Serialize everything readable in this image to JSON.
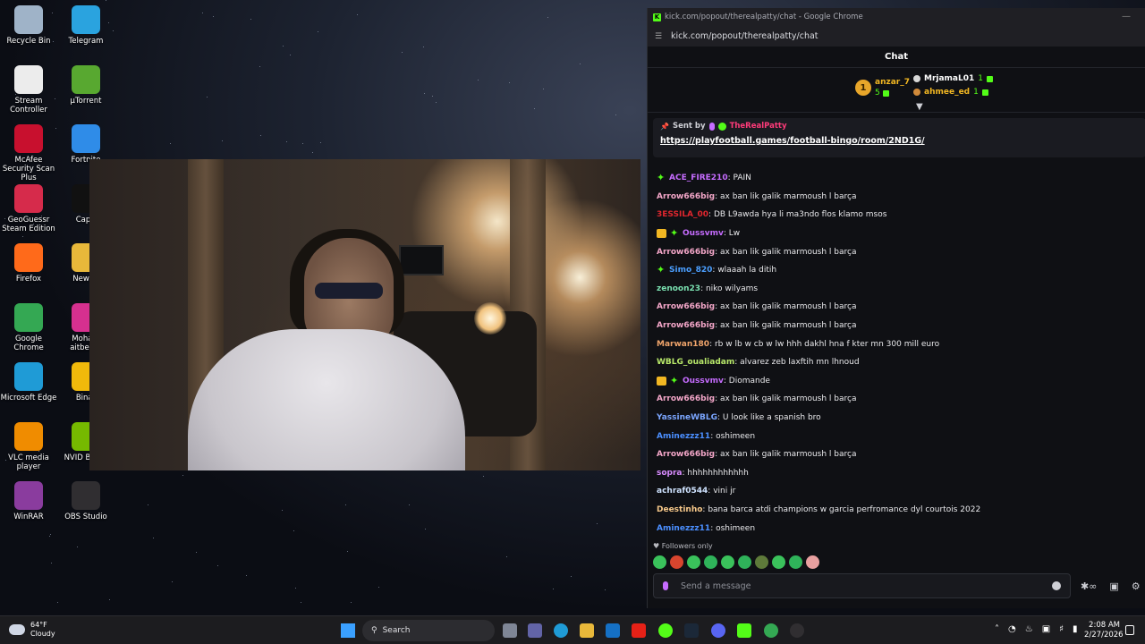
{
  "desktop_icons": [
    {
      "label": "Recycle Bin",
      "icon": "recycle-bin-icon",
      "color": "#9fb3c8"
    },
    {
      "label": "Telegram",
      "icon": "telegram-icon",
      "color": "#2aa3df"
    },
    {
      "label": "Stream Controller",
      "icon": "stream-controller-icon",
      "color": "#ececec"
    },
    {
      "label": "µTorrent",
      "icon": "utorrent-icon",
      "color": "#58a830"
    },
    {
      "label": "McAfee Security Scan Plus",
      "icon": "mcafee-icon",
      "color": "#c8102e"
    },
    {
      "label": "Fortnite",
      "icon": "fortnite-icon",
      "color": "#2f8ce8"
    },
    {
      "label": "GeoGuessr Steam Edition",
      "icon": "geoguessr-icon",
      "color": "#d62b4b"
    },
    {
      "label": "CapC",
      "icon": "capcut-icon",
      "color": "#111111"
    },
    {
      "label": "Firefox",
      "icon": "firefox-icon",
      "color": "#ff6a1a"
    },
    {
      "label": "New fo",
      "icon": "folder-icon",
      "color": "#e8b83a"
    },
    {
      "label": "Google Chrome",
      "icon": "chrome-icon",
      "color": "#34a853"
    },
    {
      "label": "Moham aitbenar",
      "icon": "instagram-icon",
      "color": "#d6308f"
    },
    {
      "label": "Microsoft Edge",
      "icon": "edge-icon",
      "color": "#1f9bd6"
    },
    {
      "label": "Binar",
      "icon": "binance-icon",
      "color": "#f0b90b"
    },
    {
      "label": "VLC media player",
      "icon": "vlc-icon",
      "color": "#f08c00"
    },
    {
      "label": "NVID Broad",
      "icon": "nvidia-icon",
      "color": "#76b900"
    },
    {
      "label": "WinRAR",
      "icon": "winrar-icon",
      "color": "#8a3c9e"
    },
    {
      "label": "OBS Studio",
      "icon": "obs-icon",
      "color": "#302e31"
    }
  ],
  "chrome": {
    "title": "kick.com/popout/therealpatty/chat - Google Chrome",
    "url": "kick.com/popout/therealpatty/chat"
  },
  "chat": {
    "header": "Chat",
    "leaderboard": {
      "first": {
        "rank": "1",
        "name": "anzar_7",
        "count": "5"
      },
      "second": {
        "name": "MrjamaL01",
        "count": "1"
      },
      "third": {
        "name": "ahmee_ed",
        "count": "1"
      }
    },
    "pinned": {
      "sent_by_label": "Sent by",
      "sender": "TheRealPatty",
      "link": "https://playfootball.games/football-bingo/room/2ND1G/"
    },
    "messages": [
      {
        "badges": [
          "star"
        ],
        "user": "ACE_FIRE210",
        "color": "#c66cff",
        "text": ": PAIN"
      },
      {
        "badges": [],
        "user": "Arrow666big",
        "color": "#f3a6c8",
        "text": ": ax ban lik galik marmoush l barça"
      },
      {
        "badges": [],
        "user": "3ESSILA_00",
        "color": "#e0262e",
        "text": ": DB L9awda hya li ma3ndo flos klamo msos"
      },
      {
        "badges": [
          "crown",
          "star"
        ],
        "user": "Oussvmv",
        "color": "#c66cff",
        "text": ": Lw"
      },
      {
        "badges": [],
        "user": "Arrow666big",
        "color": "#f3a6c8",
        "text": ": ax ban lik galik marmoush l barça"
      },
      {
        "badges": [
          "star"
        ],
        "user": "Simo_820",
        "color": "#4b9fff",
        "text": ": wlaaah la ditih"
      },
      {
        "badges": [],
        "user": "zenoon23",
        "color": "#7ae0b0",
        "text": ": niko wilyams"
      },
      {
        "badges": [],
        "user": "Arrow666big",
        "color": "#f3a6c8",
        "text": ": ax ban lik galik marmoush l barça"
      },
      {
        "badges": [],
        "user": "Arrow666big",
        "color": "#f3a6c8",
        "text": ": ax ban lik galik marmoush l barça"
      },
      {
        "badges": [],
        "user": "Marwan180",
        "color": "#f1a56b",
        "text": ": rb w lb w cb w lw hhh dakhl hna f kter mn 300 mill euro"
      },
      {
        "badges": [],
        "user": "WBLG_oualiadam",
        "color": "#b8e86a",
        "text": ": alvarez zeb laxftih mn lhnoud"
      },
      {
        "badges": [
          "crown",
          "star"
        ],
        "user": "Oussvmv",
        "color": "#c66cff",
        "text": ": Diomande"
      },
      {
        "badges": [],
        "user": "Arrow666big",
        "color": "#f3a6c8",
        "text": ": ax ban lik galik marmoush l barça"
      },
      {
        "badges": [],
        "user": "YassineWBLG",
        "color": "#7ba6ff",
        "text": ": U look like a spanish bro"
      },
      {
        "badges": [],
        "user": "Aminezzz11",
        "color": "#4b8fff",
        "text": ": oshimeen"
      },
      {
        "badges": [],
        "user": "Arrow666big",
        "color": "#f3a6c8",
        "text": ": ax ban lik galik marmoush l barça"
      },
      {
        "badges": [],
        "user": "sopra",
        "color": "#d98cff",
        "text": ": hhhhhhhhhhhh"
      },
      {
        "badges": [],
        "user": "achraf0544",
        "color": "#cfe3ff",
        "text": ": vini jr"
      },
      {
        "badges": [],
        "user": "Deestinho",
        "color": "#f6c88a",
        "text": ": bana barca atdi champions w garcia perfromance dyl courtois 2022"
      },
      {
        "badges": [],
        "user": "Aminezzz11",
        "color": "#4b8fff",
        "text": ": oshimeen"
      }
    ],
    "followers_only": "Followers only",
    "input_placeholder": "Send a message"
  },
  "taskbar": {
    "weather_temp": "64°F",
    "weather_desc": "Cloudy",
    "search_label": "Search",
    "time": "2:08 AM",
    "date": "2/27/2026"
  }
}
